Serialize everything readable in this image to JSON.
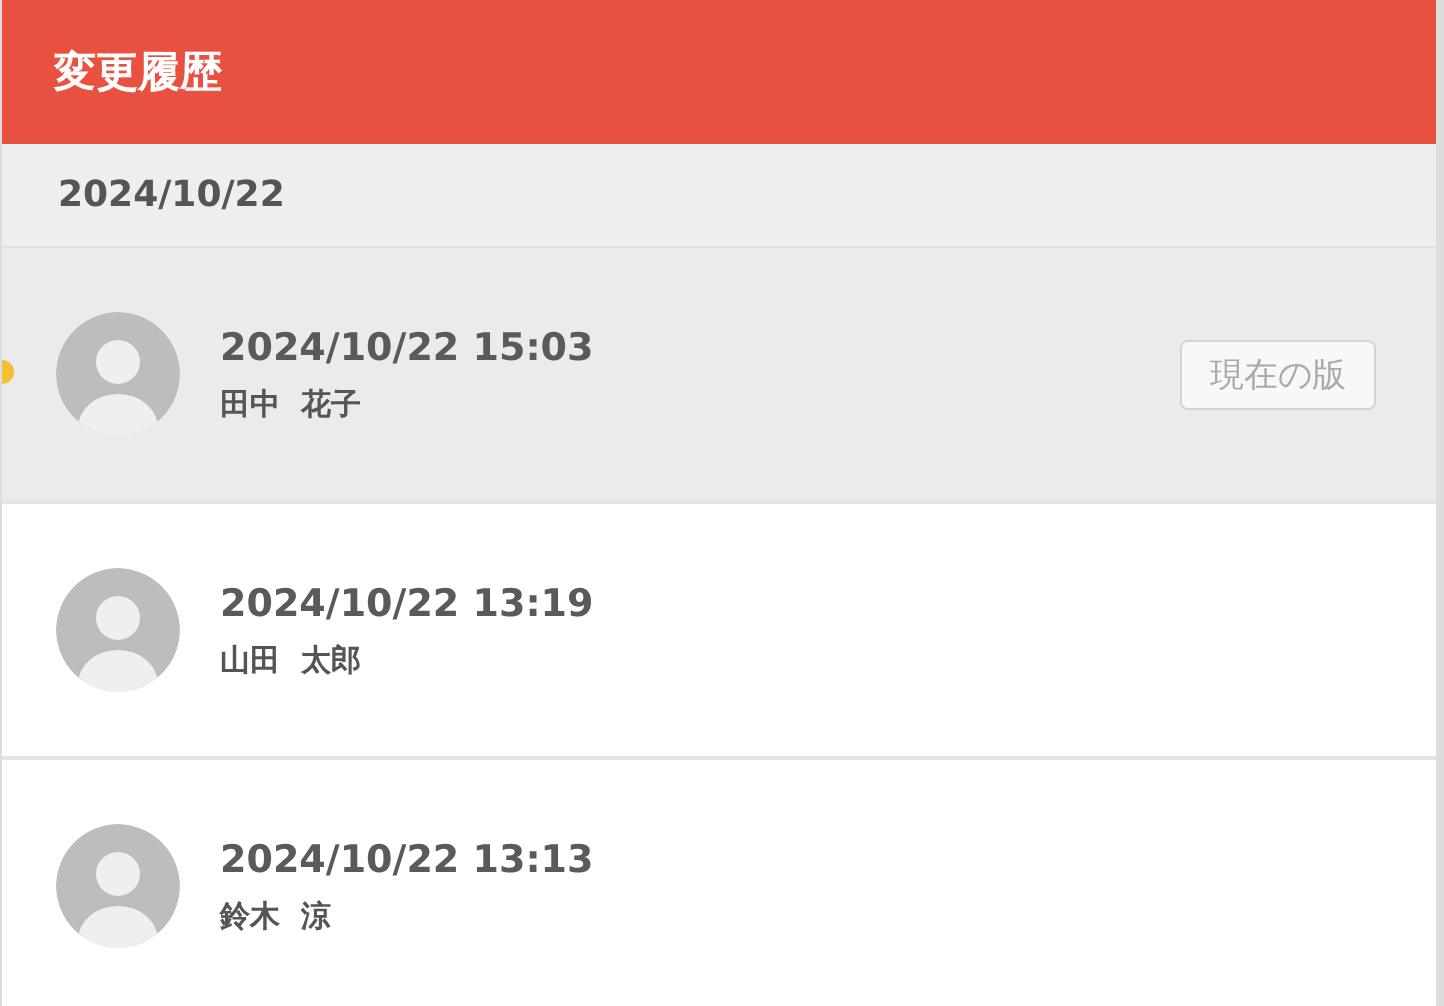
{
  "header": {
    "title": "変更履歴"
  },
  "groups": [
    {
      "date": "2024/10/22",
      "entries": [
        {
          "time": "2024/10/22 15:03",
          "user": "田中  花子",
          "selected": true,
          "badge": "現在の版"
        },
        {
          "time": "2024/10/22 13:19",
          "user": "山田  太郎",
          "selected": false
        },
        {
          "time": "2024/10/22 13:13",
          "user": "鈴木  涼",
          "selected": false
        }
      ]
    }
  ]
}
